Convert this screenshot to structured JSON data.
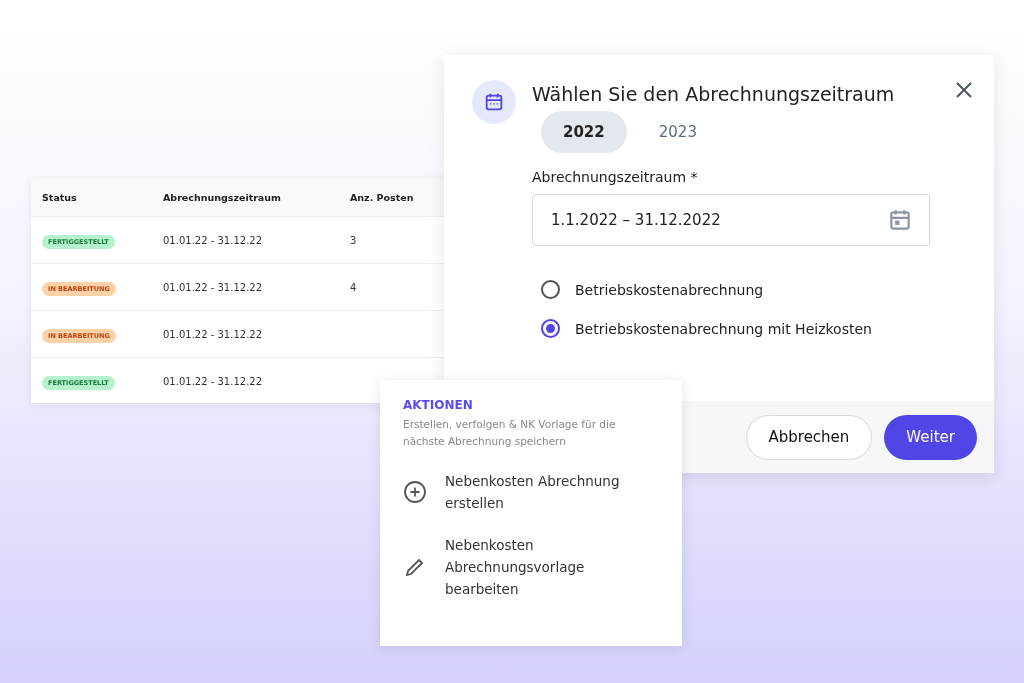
{
  "table": {
    "columns": [
      "Status",
      "Abrechnungszeitraum",
      "Anz. Posten"
    ],
    "rows": [
      {
        "status": "FERTIGGESTELLT",
        "kind": "done",
        "period": "01.01.22 - 31.12.22",
        "count": "3"
      },
      {
        "status": "IN BEARBEITUNG",
        "kind": "progress",
        "period": "01.01.22 - 31.12.22",
        "count": "4"
      },
      {
        "status": "IN BEARBEITUNG",
        "kind": "progress",
        "period": "01.01.22 - 31.12.22"
      },
      {
        "status": "FERTIGGESTELLT",
        "kind": "done",
        "period": "01.01.22 - 31.12.22"
      }
    ]
  },
  "dialog": {
    "title": "Wählen Sie den Abrechnungszeitraum",
    "tabs": [
      {
        "label": "2022",
        "selected": true
      },
      {
        "label": "2023",
        "selected": false
      }
    ],
    "field": {
      "label": "Abrechnungszeitraum *",
      "value": "1.1.2022 – 31.12.2022"
    },
    "options": [
      {
        "label": "Betriebskostenabrechnung",
        "selected": false
      },
      {
        "label": "Betriebskostenabrechnung mit Heizkosten",
        "selected": true
      }
    ],
    "buttons": [
      {
        "label": "Abbrechen",
        "kind": "secondary"
      },
      {
        "label": "Weiter",
        "kind": "primary"
      }
    ]
  },
  "actions": {
    "title": "AKTIONEN",
    "subtitle": "Erstellen, verfolgen & NK Vorlage für die nächste Abrechnung speichern",
    "items": [
      {
        "label": "Nebenkosten Abrechnung erstellen",
        "kind": "add"
      },
      {
        "label": "Nebenkosten Abrechnungsvorlage bearbeiten",
        "kind": "edit"
      }
    ]
  }
}
